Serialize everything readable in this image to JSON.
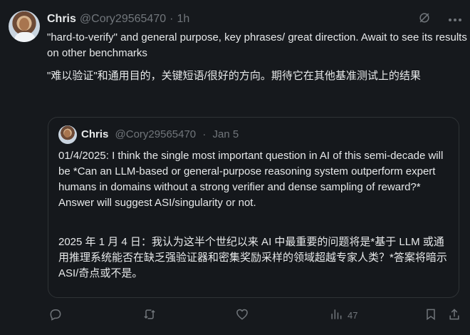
{
  "tweet": {
    "author": "Chris",
    "handle": "@Cory29565470",
    "separator": "·",
    "time": "1h",
    "text_en": "\"hard-to-verify\" and general purpose, key phrases/ great direction.  Await to see its results on other benchmarks",
    "text_zh": "\"难以验证\"和通用目的，关键短语/很好的方向。期待它在其他基准测试上的结果"
  },
  "quoted": {
    "author": "Chris",
    "handle": "@Cory29565470",
    "separator": "·",
    "time": "Jan 5",
    "text_en": "01/4/2025: I think the single most important question in AI of this semi-decade will be *Can an LLM-based or general-purpose reasoning system outperform expert humans in domains without a strong verifier and dense sampling of reward?* Answer will suggest ASI/singularity or not.",
    "text_zh": "2025 年 1 月 4 日：我认为这半个世纪以来 AI 中最重要的问题将是*基于 LLM 或通用推理系统能否在缺乏强验证器和密集奖励采样的领域超越专家人类？*答案将暗示 ASI/奇点或不是。"
  },
  "actions": {
    "views": "47"
  },
  "icons": {
    "grok": "grok-icon",
    "more": "more-icon",
    "reply": "reply-icon",
    "retweet": "retweet-icon",
    "like": "heart-icon",
    "views": "views-icon",
    "bookmark": "bookmark-icon",
    "share": "share-icon"
  },
  "colors": {
    "background": "#16191d",
    "text": "#e7e9ea",
    "secondary": "#71767b",
    "border": "#2f3336"
  }
}
